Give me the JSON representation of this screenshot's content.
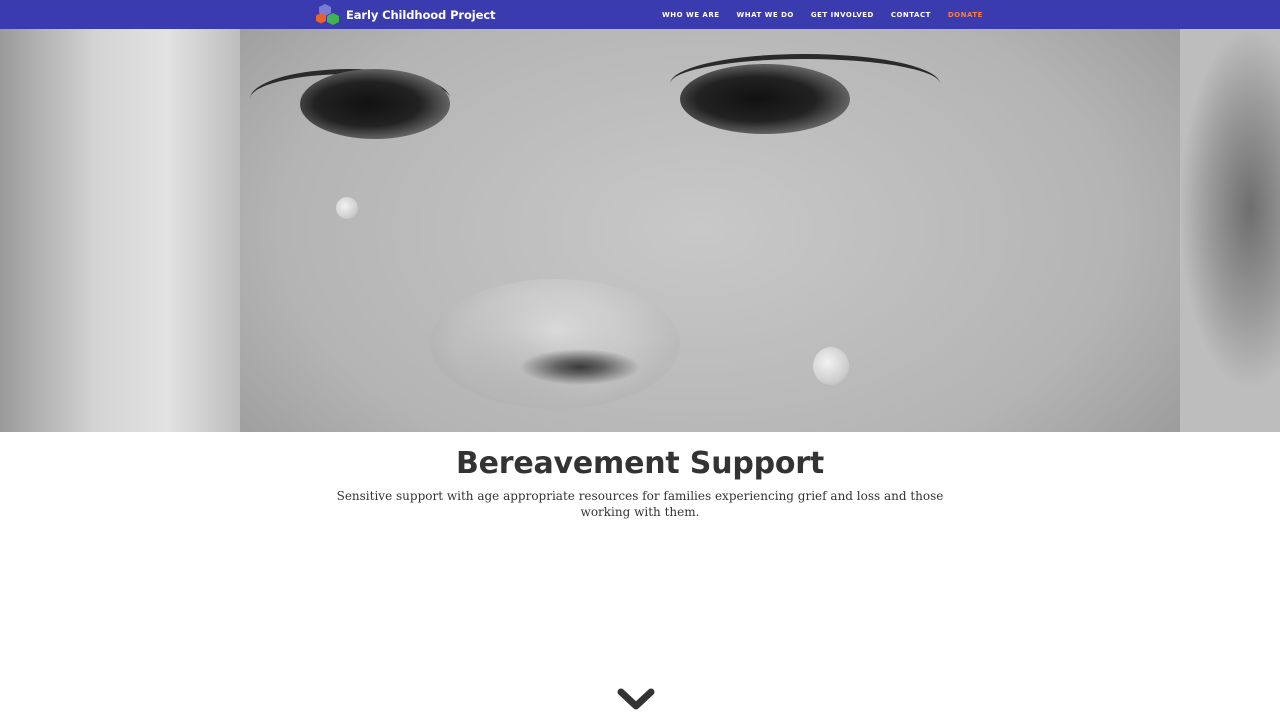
{
  "header": {
    "brand": "Early Childhood Project",
    "logo_colors": [
      "#7b7bd4",
      "#e8622a",
      "#3fb34f"
    ],
    "background": "#3b3bb0",
    "nav": [
      {
        "label": "WHO WE ARE"
      },
      {
        "label": "WHAT WE DO"
      },
      {
        "label": "GET INVOLVED"
      },
      {
        "label": "CONTACT"
      },
      {
        "label": "DONATE",
        "color": "#ff7a3d"
      }
    ]
  },
  "hero": {
    "image_icon": "hero-photo"
  },
  "main": {
    "title": "Bereavement Support",
    "description": "Sensitive support with age appropriate resources for families experiencing grief and loss and those working with them."
  },
  "scroll": {
    "icon": "chevron-down-icon"
  }
}
